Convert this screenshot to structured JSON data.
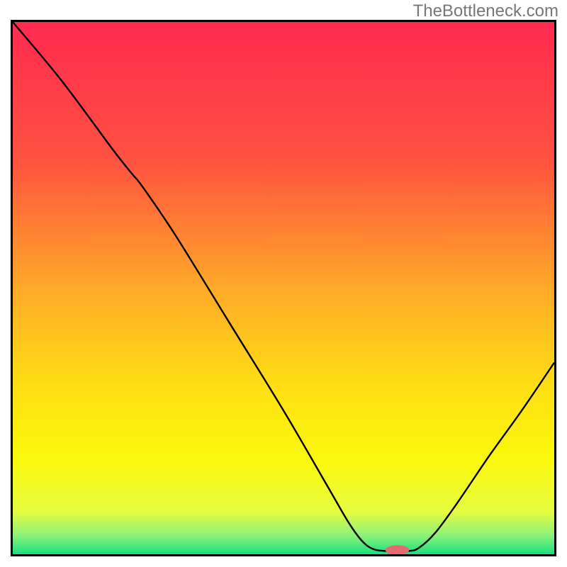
{
  "watermark": "TheBottleneck.com",
  "chart_data": {
    "type": "line",
    "title": "",
    "xlabel": "",
    "ylabel": "",
    "xlim": [
      0,
      100
    ],
    "ylim": [
      0,
      100
    ],
    "gradient_stops": [
      {
        "offset": 0.0,
        "color": "#ff2a4f"
      },
      {
        "offset": 0.26,
        "color": "#ff5240"
      },
      {
        "offset": 0.5,
        "color": "#ffa928"
      },
      {
        "offset": 0.68,
        "color": "#fede14"
      },
      {
        "offset": 0.82,
        "color": "#faf80b"
      },
      {
        "offset": 0.92,
        "color": "#e7fc40"
      },
      {
        "offset": 0.965,
        "color": "#8bf27a"
      },
      {
        "offset": 1.0,
        "color": "#18e07e"
      }
    ],
    "curve": [
      {
        "x": 0.0,
        "y": 100.0
      },
      {
        "x": 9.0,
        "y": 89.0
      },
      {
        "x": 18.5,
        "y": 76.0
      },
      {
        "x": 22.0,
        "y": 71.5
      },
      {
        "x": 24.0,
        "y": 69.0
      },
      {
        "x": 30.0,
        "y": 60.0
      },
      {
        "x": 40.0,
        "y": 43.5
      },
      {
        "x": 50.0,
        "y": 27.0
      },
      {
        "x": 58.0,
        "y": 13.0
      },
      {
        "x": 62.0,
        "y": 6.0
      },
      {
        "x": 64.5,
        "y": 2.5
      },
      {
        "x": 66.5,
        "y": 1.0
      },
      {
        "x": 69.0,
        "y": 0.6
      },
      {
        "x": 73.0,
        "y": 0.6
      },
      {
        "x": 75.0,
        "y": 1.2
      },
      {
        "x": 78.0,
        "y": 4.0
      },
      {
        "x": 82.0,
        "y": 9.5
      },
      {
        "x": 88.0,
        "y": 18.5
      },
      {
        "x": 94.0,
        "y": 27.0
      },
      {
        "x": 100.0,
        "y": 36.0
      }
    ],
    "marker": {
      "x": 71.0,
      "y": 0.8,
      "rx": 2.2,
      "ry": 0.9,
      "color": "#e46a6f"
    }
  }
}
